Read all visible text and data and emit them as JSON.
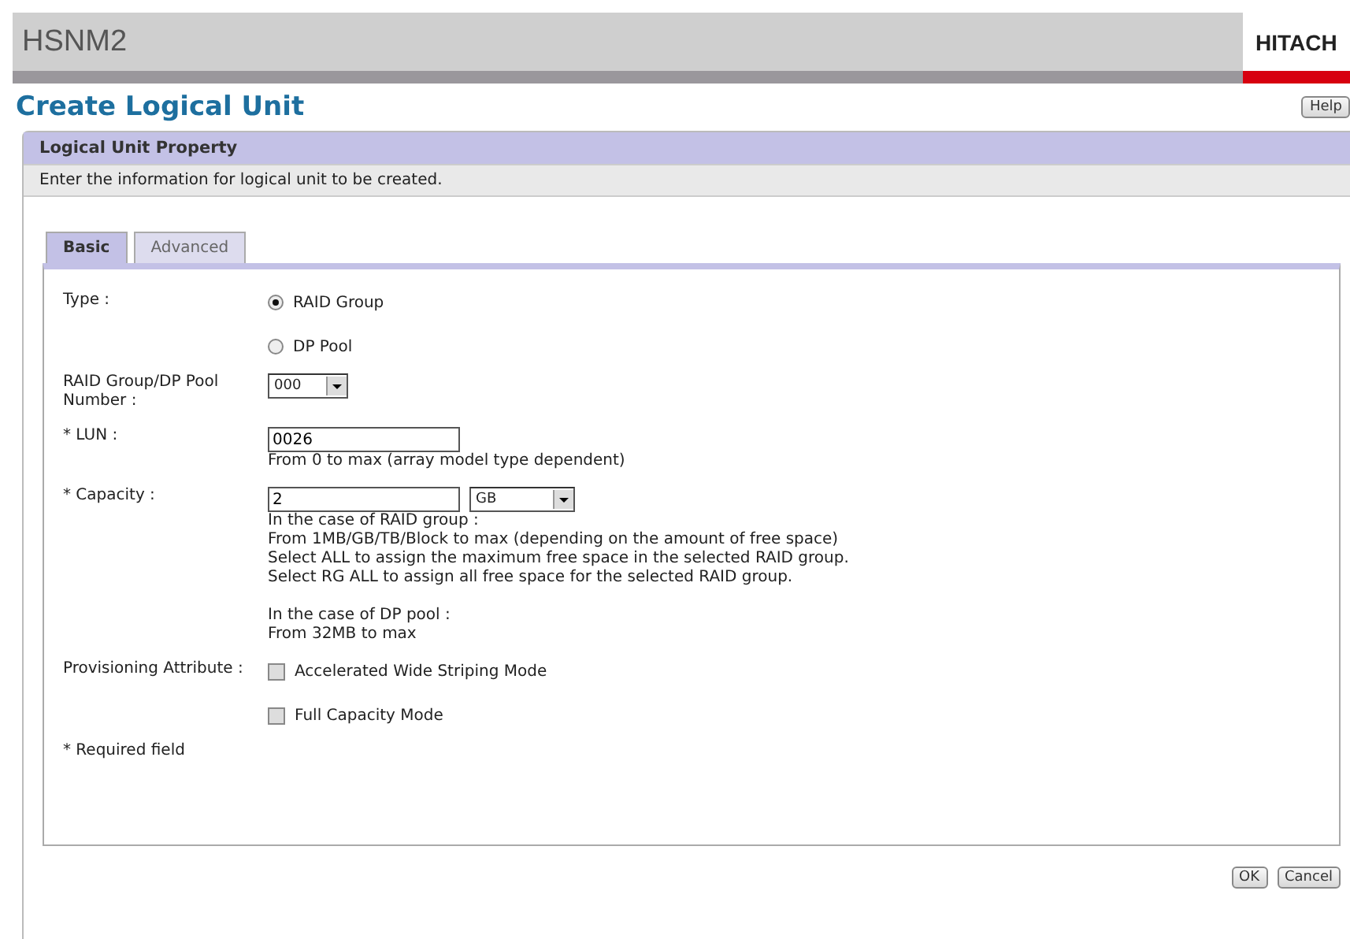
{
  "app_header": {
    "product": "HSNM2",
    "brand": "HITACH"
  },
  "page": {
    "title": "Create Logical Unit",
    "help_button": "Help"
  },
  "panel": {
    "title": "Logical Unit Property",
    "description": "Enter the information for logical unit to be created."
  },
  "tabs": [
    {
      "label": "Basic",
      "selected": true
    },
    {
      "label": "Advanced",
      "selected": false
    }
  ],
  "form": {
    "type": {
      "label": "Type :",
      "options": [
        {
          "label": "RAID Group",
          "selected": true
        },
        {
          "label": "DP Pool",
          "selected": false
        }
      ]
    },
    "pool_number": {
      "label": "RAID Group/DP Pool Number :",
      "value": "000"
    },
    "lun": {
      "label": "* LUN :",
      "value": "0026",
      "hint": "From 0 to max (array model type dependent)"
    },
    "capacity": {
      "label": "* Capacity :",
      "value": "2",
      "unit": "GB",
      "hints": [
        "In the case of RAID group :",
        "From 1MB/GB/TB/Block to max (depending on the amount of free space)",
        "Select ALL to assign the maximum free space in the selected RAID group.",
        "Select RG ALL to assign all free space for the selected RAID group."
      ],
      "hints_dp": [
        "In the case of DP pool :",
        "From 32MB to max"
      ]
    },
    "provisioning": {
      "label": "Provisioning Attribute :",
      "options": [
        {
          "label": "Accelerated Wide Striping Mode",
          "checked": false
        },
        {
          "label": "Full Capacity Mode",
          "checked": false
        }
      ]
    },
    "required_note": "* Required field"
  },
  "buttons": [
    "OK",
    "Cancel"
  ]
}
